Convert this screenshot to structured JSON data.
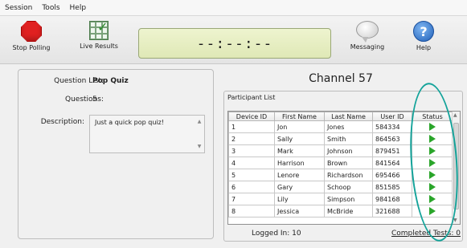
{
  "menu": [
    "Session",
    "Tools",
    "Help"
  ],
  "toolbar": {
    "stop_polling": "Stop Polling",
    "live_results": "Live Results",
    "timer": "--:--:--",
    "messaging": "Messaging",
    "help": "Help"
  },
  "quiz": {
    "question_list_label": "Question List:",
    "question_list_value": "Pop Quiz",
    "questions_label": "Questions:",
    "questions_value": "5",
    "description_label": "Description:",
    "description_value": "Just a quick pop quiz!"
  },
  "channel_title": "Channel 57",
  "participant_list_label": "Participant List",
  "table": {
    "headers": [
      "Device ID",
      "First Name",
      "Last Name",
      "User ID",
      "Status"
    ],
    "rows": [
      [
        "1",
        "Jon",
        "Jones",
        "584334",
        "play"
      ],
      [
        "2",
        "Sally",
        "Smith",
        "864563",
        "play"
      ],
      [
        "3",
        "Mark",
        "Johnson",
        "879451",
        "play"
      ],
      [
        "4",
        "Harrison",
        "Brown",
        "841564",
        "play"
      ],
      [
        "5",
        "Lenore",
        "Richardson",
        "695466",
        "play"
      ],
      [
        "6",
        "Gary",
        "Schoop",
        "851585",
        "play"
      ],
      [
        "7",
        "Lily",
        "Simpson",
        "984168",
        "play"
      ],
      [
        "8",
        "Jessica",
        "McBride",
        "321688",
        "play"
      ]
    ]
  },
  "footer": {
    "logged_in": "Logged In: 10",
    "completed_tests": "Completed Tests: 0"
  },
  "colors": {
    "status_play": "#2aa52a",
    "annotation_oval": "#14a39a"
  }
}
